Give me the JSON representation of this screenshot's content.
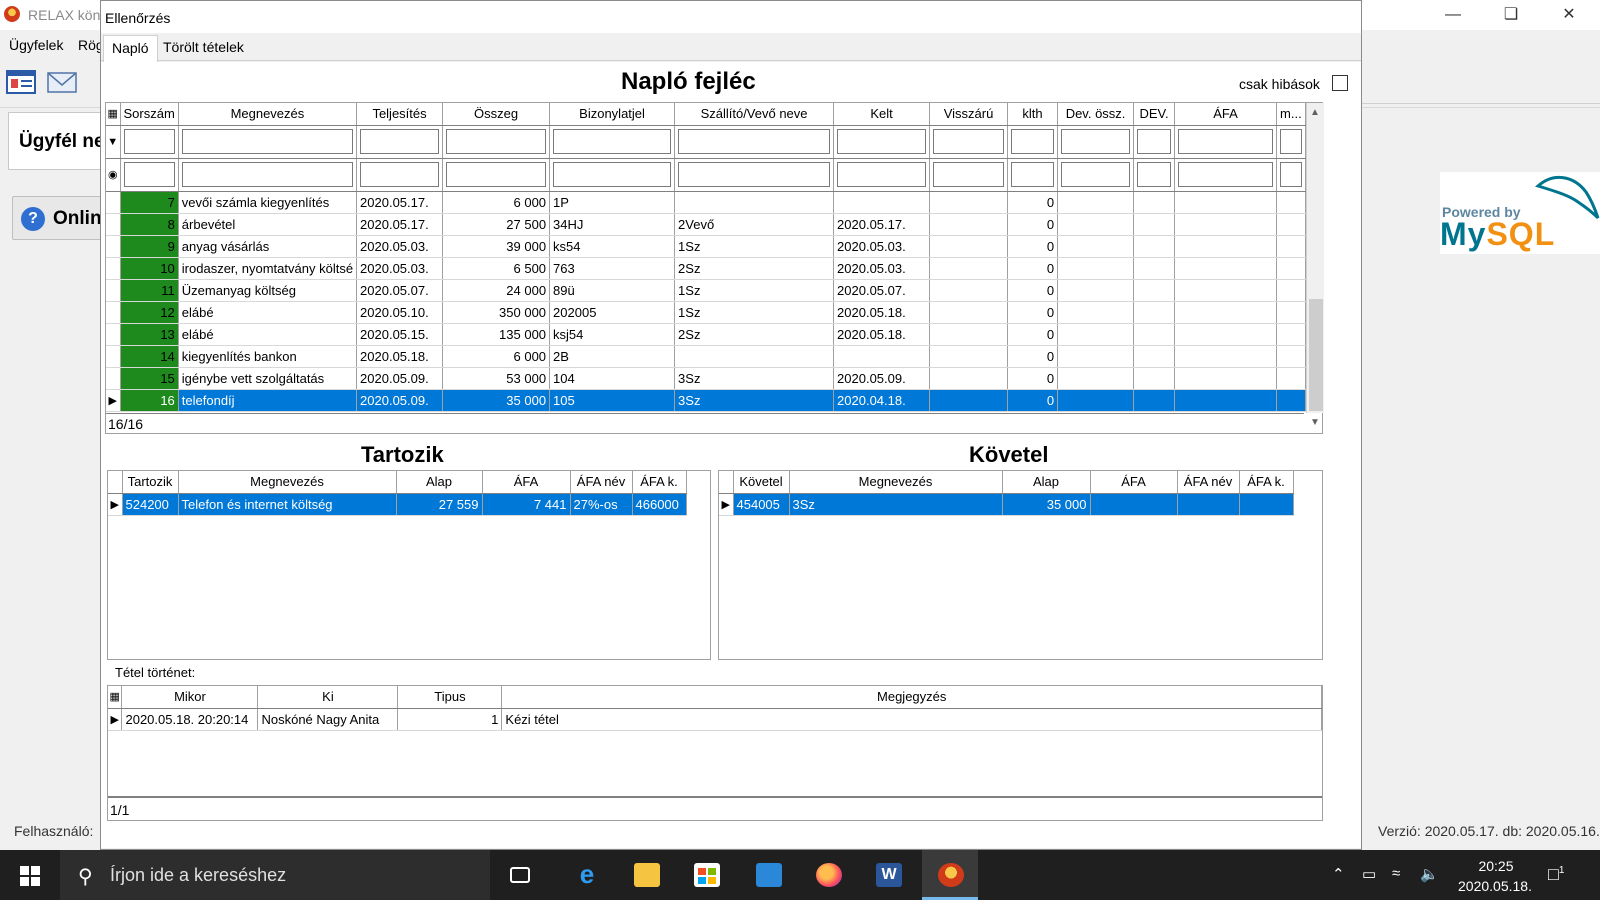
{
  "app": {
    "title": "RELAX kön",
    "menu": [
      "Ügyfelek",
      "Rög"
    ],
    "panel_text": "Ügyfél ne",
    "online_label": "Onlin",
    "status_left": "Felhasználó:",
    "status_right": "Verzió: 2020.05.17. db: 2020.05.16.",
    "mysql_powered": "Powered by",
    "mysql_word_a": "My",
    "mysql_word_b": "SQL"
  },
  "dialog": {
    "title": "Ellenőrzés",
    "tabs": [
      "Napló",
      "Törölt tételek"
    ],
    "header_title": "Napló fejléc",
    "only_errors_label": "csak hibások",
    "main_grid": {
      "columns": [
        "Sorszám",
        "Megnevezés",
        "Teljesítés",
        "Összeg",
        "Bizonylatjel",
        "Szállító/Vevő neve",
        "Kelt",
        "Visszárú",
        "klth",
        "Dev. össz.",
        "DEV.",
        "ÁFA",
        "m..."
      ],
      "rows": [
        [
          "7",
          "vevői számla kiegyenlítés",
          "2020.05.17.",
          "6 000",
          "1P",
          "",
          "",
          "",
          "0",
          "",
          "",
          "",
          ""
        ],
        [
          "8",
          "árbevétel",
          "2020.05.17.",
          "27 500",
          "34HJ",
          "2Vevő",
          "2020.05.17.",
          "",
          "0",
          "",
          "",
          "",
          ""
        ],
        [
          "9",
          "anyag vásárlás",
          "2020.05.03.",
          "39 000",
          "ks54",
          "1Sz",
          "2020.05.03.",
          "",
          "0",
          "",
          "",
          "",
          ""
        ],
        [
          "10",
          "irodaszer, nyomtatvány költsé",
          "2020.05.03.",
          "6 500",
          "763",
          "2Sz",
          "2020.05.03.",
          "",
          "0",
          "",
          "",
          "",
          ""
        ],
        [
          "11",
          "Üzemanyag költség",
          "2020.05.07.",
          "24 000",
          "89ü",
          "1Sz",
          "2020.05.07.",
          "",
          "0",
          "",
          "",
          "",
          ""
        ],
        [
          "12",
          "elábé",
          "2020.05.10.",
          "350 000",
          "202005",
          "1Sz",
          "2020.05.18.",
          "",
          "0",
          "",
          "",
          "",
          ""
        ],
        [
          "13",
          "elábé",
          "2020.05.15.",
          "135 000",
          "ksj54",
          "2Sz",
          "2020.05.18.",
          "",
          "0",
          "",
          "",
          "",
          ""
        ],
        [
          "14",
          "kiegyenlítés bankon",
          "2020.05.18.",
          "6 000",
          "2B",
          "",
          "",
          "",
          "0",
          "",
          "",
          "",
          ""
        ],
        [
          "15",
          "igénybe vett szolgáltatás",
          "2020.05.09.",
          "53 000",
          "104",
          "3Sz",
          "2020.05.09.",
          "",
          "0",
          "",
          "",
          "",
          ""
        ],
        [
          "16",
          "telefondíj",
          "2020.05.09.",
          "35 000",
          "105",
          "3Sz",
          "2020.04.18.",
          "",
          "0",
          "",
          "",
          "",
          ""
        ]
      ],
      "selected_index": 9,
      "record_count": "16/16"
    },
    "tartozik": {
      "title": "Tartozik",
      "columns": [
        "Tartozik",
        "Megnevezés",
        "Alap",
        "ÁFA",
        "ÁFA név",
        "ÁFA k."
      ],
      "rows": [
        [
          "524200",
          "Telefon és internet költség",
          "27 559",
          "7 441",
          "27%-os",
          "466000"
        ]
      ]
    },
    "kovetel": {
      "title": "Követel",
      "columns": [
        "Követel",
        "Megnevezés",
        "Alap",
        "ÁFA",
        "ÁFA név",
        "ÁFA k."
      ],
      "rows": [
        [
          "454005",
          "3Sz",
          "35 000",
          "",
          "",
          ""
        ]
      ]
    },
    "history": {
      "label": "Tétel történet:",
      "columns": [
        "Mikor",
        "Ki",
        "Tipus",
        "Megjegyzés"
      ],
      "rows": [
        [
          "2020.05.18. 20:20:14",
          "Noskóné Nagy Anita",
          "1",
          "Kézi tétel"
        ]
      ],
      "record_count": "1/1"
    }
  },
  "taskbar": {
    "search_placeholder": "Írjon ide a kereséshez",
    "time": "20:25",
    "date": "2020.05.18.",
    "notification_count": "1"
  }
}
